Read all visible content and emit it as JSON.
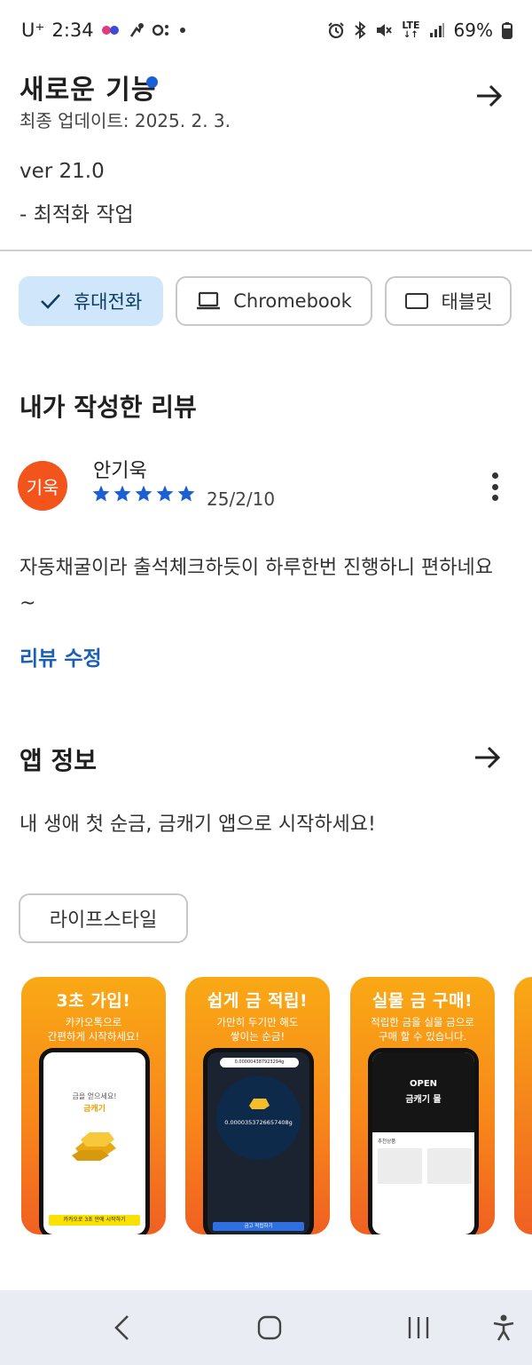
{
  "status_bar": {
    "carrier": "U⁺",
    "time": "2:34",
    "lte": "LTE",
    "battery": "69%"
  },
  "whats_new": {
    "title": "새로운 기능",
    "last_updated": "최종 업데이트: 2025. 2. 3.",
    "version": "ver 21.0",
    "changes": "- 최적화 작업"
  },
  "device_tabs": [
    {
      "label": "휴대전화",
      "selected": true,
      "icon": "check-icon"
    },
    {
      "label": "Chromebook",
      "selected": false,
      "icon": "laptop-icon"
    },
    {
      "label": "태블릿",
      "selected": false,
      "icon": "tablet-icon"
    }
  ],
  "my_review": {
    "section_title": "내가 작성한 리뷰",
    "avatar_text": "기욱",
    "avatar_color": "#f2541b",
    "reviewer": "안기욱",
    "rating": 5,
    "date": "25/2/10",
    "text": "자동채굴이라 출석체크하듯이 하루한번 진행하니 편하네요~",
    "edit_label": "리뷰 수정"
  },
  "app_info": {
    "section_title": "앱 정보",
    "description": "내 생애 첫 순금, 금캐기 앱으로 시작하세요!",
    "category": "라이프스타일"
  },
  "screenshots": [
    {
      "headline": "3초 가입!",
      "sub1": "카카오톡으로",
      "sub2": "간편하게 시작하세요!",
      "screen_text1": "금을 얻으세요!",
      "screen_text2": "금캐기",
      "screen_button": "카카오로 3초 만에 시작하기"
    },
    {
      "headline": "쉽게 금 적립!",
      "sub1": "가만히 두기만 해도",
      "sub2": "쌓이는 순금!",
      "screen_text1": "0.000004387923294g",
      "screen_text2": "0.0000353726657408g",
      "screen_button": "금고 적립하기"
    },
    {
      "headline": "실물 금 구매!",
      "sub1": "적립한 금을 실물 금으로",
      "sub2": "구매 할 수 있습니다.",
      "screen_text1": "OPEN",
      "screen_text2": "금캐기 몰",
      "screen_button": "추천상품"
    }
  ],
  "colors": {
    "accent_blue": "#1a5fb4",
    "star_blue": "#1a5fd6",
    "chip_selected_bg": "#cfe6fb",
    "shot_orange": "#f8871a"
  }
}
